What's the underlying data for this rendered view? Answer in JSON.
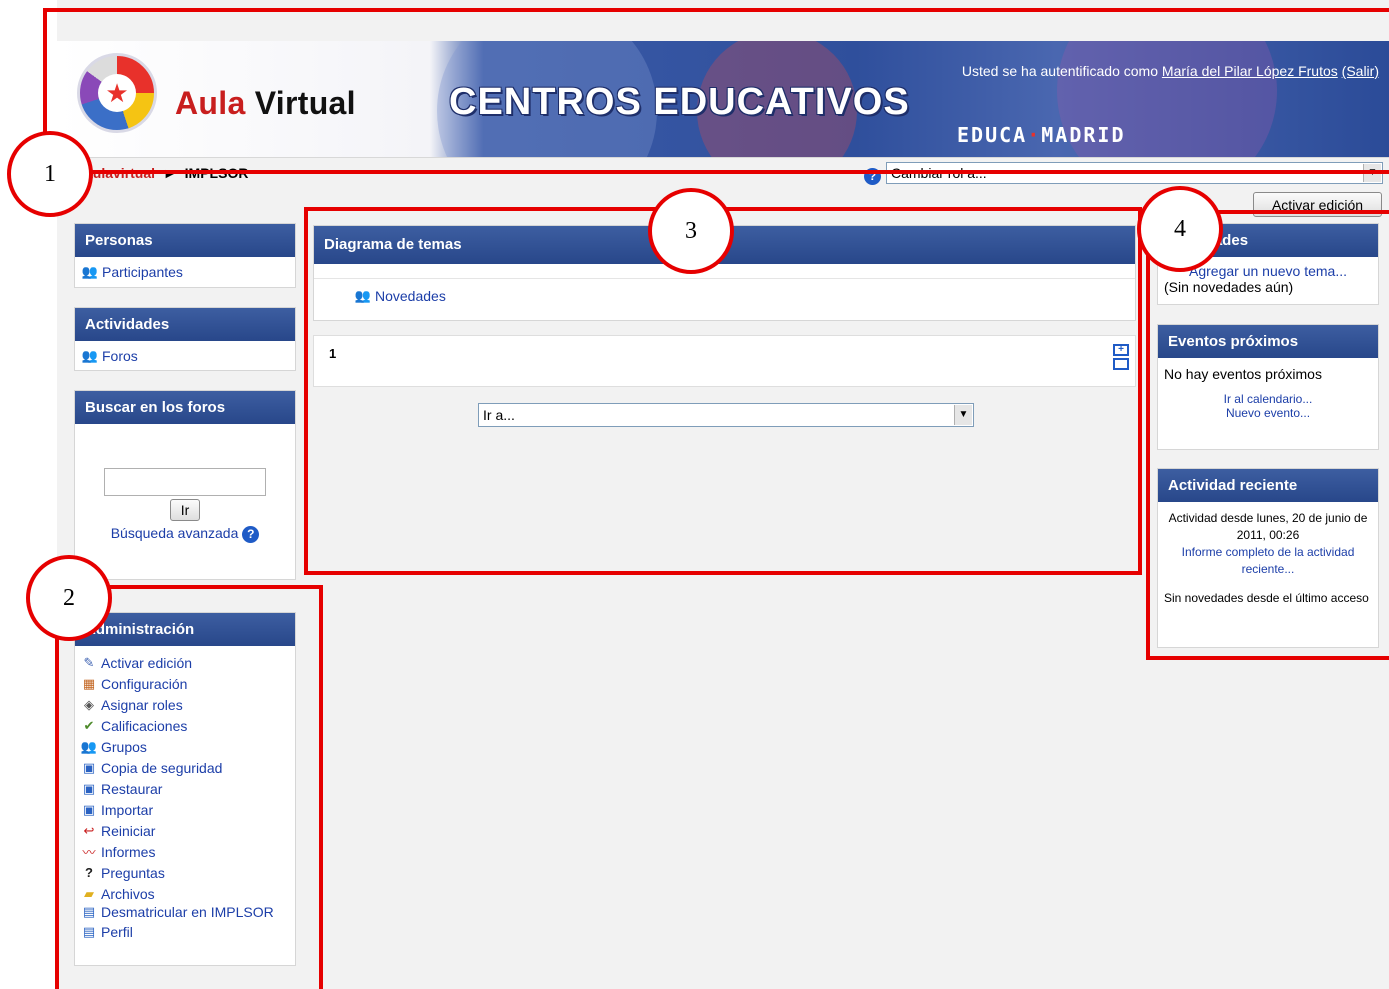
{
  "header": {
    "brand_part1": "Aula ",
    "brand_part2": "Virtual",
    "centros": "CENTROS EDUCATIVOS",
    "educa_a": "EDUCA",
    "educa_b": "MADRID",
    "login_prefix": "Usted se ha autentificado como ",
    "user_name": "María del Pilar López Frutos",
    "logout": "(Salir)"
  },
  "nav": {
    "home": "aulavirtual",
    "sep": "►",
    "course": "IMPLSOR",
    "role_select": "Cambiar rol a...",
    "edit_button": "Activar edición"
  },
  "left": {
    "personas": {
      "title": "Personas",
      "items": [
        "Participantes"
      ]
    },
    "actividades": {
      "title": "Actividades",
      "items": [
        "Foros"
      ]
    },
    "buscar": {
      "title": "Buscar en los foros",
      "go": "Ir",
      "advanced": "Búsqueda avanzada"
    },
    "admin": {
      "title": "Administración",
      "items": [
        "Activar edición",
        "Configuración",
        "Asignar roles",
        "Calificaciones",
        "Grupos",
        "Copia de seguridad",
        "Restaurar",
        "Importar",
        "Reiniciar",
        "Informes",
        "Preguntas",
        "Archivos",
        "Desmatricular en IMPLSOR",
        "Perfil"
      ]
    }
  },
  "main": {
    "title": "Diagrama de temas",
    "news": "Novedades",
    "section_number": "1",
    "goto": "Ir a..."
  },
  "right": {
    "novedades": {
      "title": "Novedades",
      "add": "Agregar un nuevo tema...",
      "none": "(Sin novedades aún)"
    },
    "eventos": {
      "title": "Eventos próximos",
      "none": "No hay eventos próximos",
      "calendar": "Ir al calendario...",
      "new": "Nuevo evento..."
    },
    "reciente": {
      "title": "Actividad reciente",
      "since": "Actividad desde lunes, 20 de junio de 2011, 00:26",
      "report": "Informe completo de la actividad reciente...",
      "none": "Sin novedades desde el último acceso"
    }
  },
  "annotations": [
    "1",
    "2",
    "3",
    "4"
  ],
  "colors": {
    "block_header": "#2f4f8f",
    "annotation_red": "#e60000",
    "link": "#1c3ea8"
  }
}
